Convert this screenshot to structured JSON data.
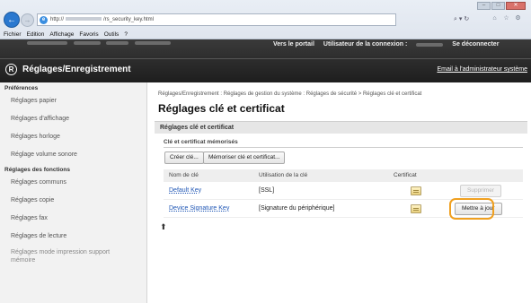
{
  "browser": {
    "url_prefix": "http://",
    "url_suffix": "/rs_security_key.html",
    "addr_tools": "⌕ ▾ ↻",
    "menu": [
      "Fichier",
      "Edition",
      "Affichage",
      "Favoris",
      "Outils",
      "?"
    ]
  },
  "header": {
    "link_portal": "Vers le portail",
    "link_user": "Utilisateur de la connexion :",
    "link_logout": "Se déconnecter",
    "title": "Réglages/Enregistrement",
    "mail": "Email à l'administrateur système"
  },
  "sidebar": {
    "group1": "Préférences",
    "items1": [
      "Réglages papier",
      "Réglages d'affichage",
      "Réglages horloge",
      "Réglage volume sonore"
    ],
    "group2": "Réglages des fonctions",
    "items2": [
      "Réglages communs",
      "Réglages copie",
      "Réglages fax",
      "Réglages de lecture"
    ],
    "item_last": "Réglages mode impression support mémoire"
  },
  "main": {
    "breadcrumb": "Réglages/Enregistrement : Réglages de gestion du système : Réglages de sécurité > Réglages clé et certificat",
    "title": "Réglages clé et certificat",
    "section": "Réglages clé et certificat",
    "subsection": "Clé et certificat mémorisés",
    "btn_create": "Créer clé...",
    "btn_register": "Mémoriser clé et certificat...",
    "table": {
      "headers": [
        "Nom de clé",
        "Utilisation de la clé",
        "Certificat",
        ""
      ],
      "rows": [
        {
          "name": "Default Key",
          "usage": "[SSL]",
          "action": "Supprimer"
        },
        {
          "name": "Device Signature Key",
          "usage": "[Signature du périphérique]",
          "action": "Mettre à jour"
        }
      ]
    }
  },
  "colors": {
    "accent_highlight": "#f0a020",
    "header_bg": "#2a2a2a",
    "link": "#1f56b5"
  },
  "icons": [
    "back-arrow-icon",
    "forward-arrow-icon",
    "ie-page-icon",
    "home-icon",
    "star-icon",
    "gear-icon",
    "logo-icon",
    "certificate-icon",
    "page-top-icon"
  ]
}
